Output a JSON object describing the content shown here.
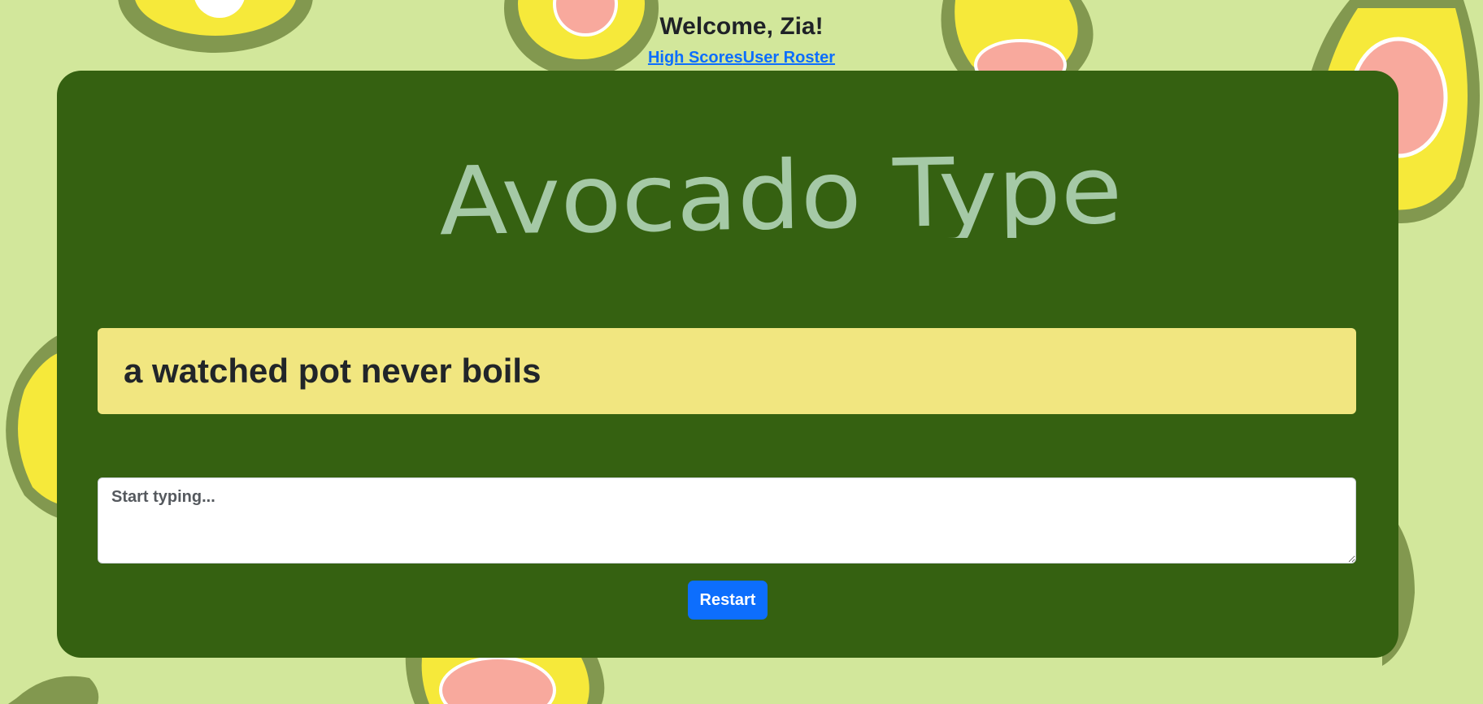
{
  "header": {
    "welcome": "Welcome, Zia!",
    "links": [
      {
        "label": "High Scores"
      },
      {
        "label": "User Roster"
      }
    ]
  },
  "game": {
    "title": "Avocado Type",
    "quote": "a watched pot never boils",
    "input": {
      "value": "",
      "placeholder": "Start typing..."
    },
    "restart_label": "Restart"
  },
  "colors": {
    "background": "#d2e79b",
    "card": "#356111",
    "title": "#a5c9a6",
    "quote_bg": "#f1e680",
    "button": "#0d6efd",
    "link": "#0d6efd"
  }
}
